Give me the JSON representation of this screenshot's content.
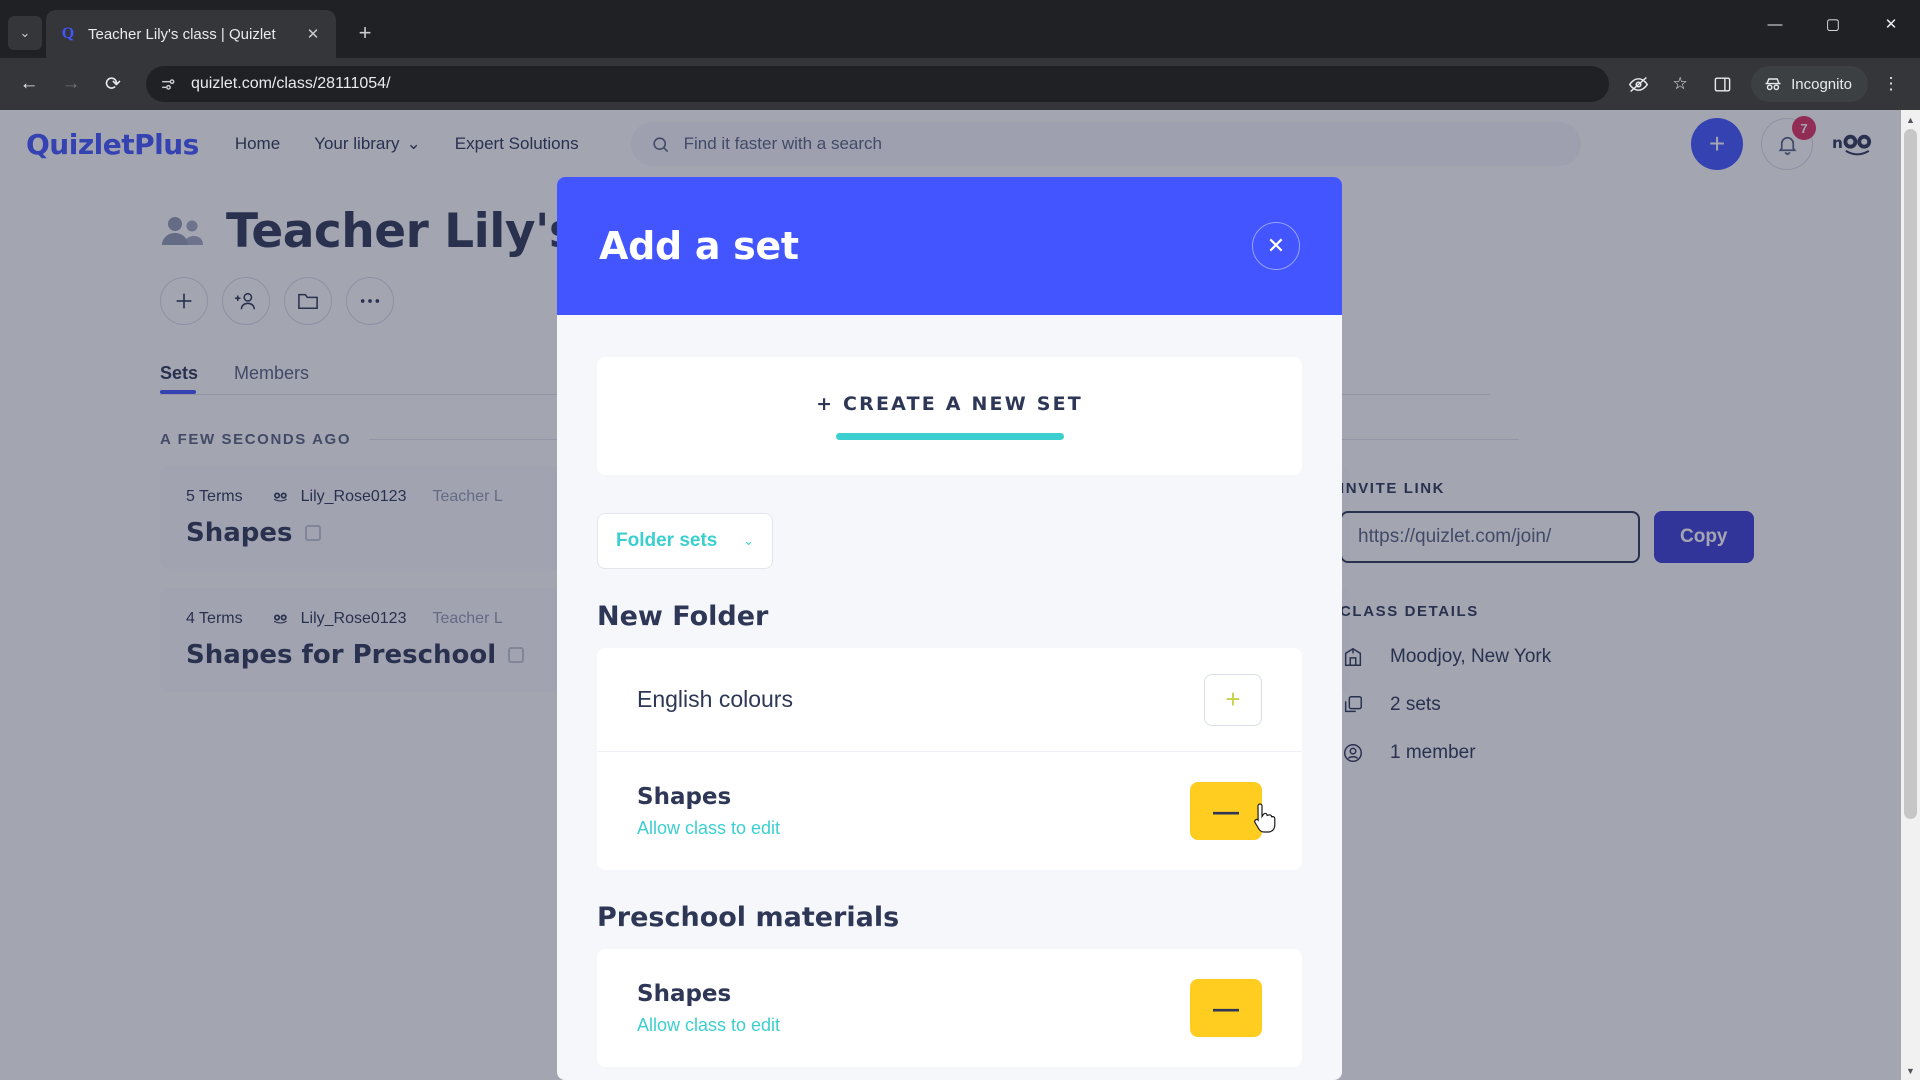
{
  "browser": {
    "tab": {
      "title": "Teacher Lily's class | Quizlet",
      "favicon_letter": "Q",
      "close_label": "✕"
    },
    "new_tab_label": "+",
    "tab_search_label": "⌄",
    "window": {
      "minimize": "—",
      "maximize": "▢",
      "close": "✕"
    },
    "nav": {
      "back": "←",
      "forward": "→",
      "reload": "⟳"
    },
    "omnibox": {
      "url": "quizlet.com/class/28111054/",
      "site_info_icon": "tune-icon"
    },
    "toolbar_right": {
      "tracking_label": "eye-off-icon",
      "bookmark_label": "☆",
      "side_panel_label": "▯",
      "incognito_label": "Incognito",
      "menu_label": "⋮"
    }
  },
  "site": {
    "logo": "QuizletPlus",
    "nav": [
      {
        "label": "Home",
        "caret": ""
      },
      {
        "label": "Your library",
        "caret": "⌄"
      },
      {
        "label": "Expert Solutions",
        "caret": ""
      }
    ],
    "search": {
      "placeholder": "Find it faster with a search"
    },
    "header_right": {
      "create_label": "+",
      "notifications_count": "7",
      "avatar_label": "nOOc"
    }
  },
  "class": {
    "title": "Teacher Lily's",
    "actions": [
      "add-set",
      "add-member",
      "folder",
      "more"
    ],
    "tabs": [
      {
        "label": "Sets",
        "active": true
      },
      {
        "label": "Members",
        "active": false
      }
    ],
    "time_label": "A FEW SECONDS AGO",
    "sets": [
      {
        "terms": "5 Terms",
        "author": "Lily_Rose0123",
        "class_tag": "Teacher L",
        "name": "Shapes"
      },
      {
        "terms": "4 Terms",
        "author": "Lily_Rose0123",
        "class_tag": "Teacher L",
        "name": "Shapes for Preschool"
      }
    ]
  },
  "rail": {
    "invite_label": "INVITE LINK",
    "invite_value": "https://quizlet.com/join/",
    "copy_label": "Copy",
    "details_label": "CLASS DETAILS",
    "details": [
      {
        "icon": "school-icon",
        "text": "Moodjoy, New York"
      },
      {
        "icon": "sets-icon",
        "text": "2 sets"
      },
      {
        "icon": "member-icon",
        "text": "1 member"
      }
    ]
  },
  "modal": {
    "title": "Add a set",
    "close_label": "✕",
    "create_label": "+ CREATE A NEW SET",
    "dropdown": {
      "label": "Folder sets",
      "caret": "⌄"
    },
    "folders": [
      {
        "title": "New Folder",
        "rows": [
          {
            "name": "English colours",
            "bold": false,
            "sub": "",
            "button": "add",
            "button_label": "+"
          },
          {
            "name": "Shapes",
            "bold": true,
            "sub": "Allow class to edit",
            "button": "remove",
            "button_label": "—"
          }
        ]
      },
      {
        "title": "Preschool materials",
        "rows": [
          {
            "name": "Shapes",
            "bold": true,
            "sub": "Allow class to edit",
            "button": "remove",
            "button_label": "—"
          }
        ]
      }
    ]
  },
  "colors": {
    "brand_blue": "#4255ff",
    "teal": "#3ccfcf",
    "yellow": "#ffcd1f",
    "badge_red": "#e02f5f",
    "text_dark": "#2e3856"
  }
}
